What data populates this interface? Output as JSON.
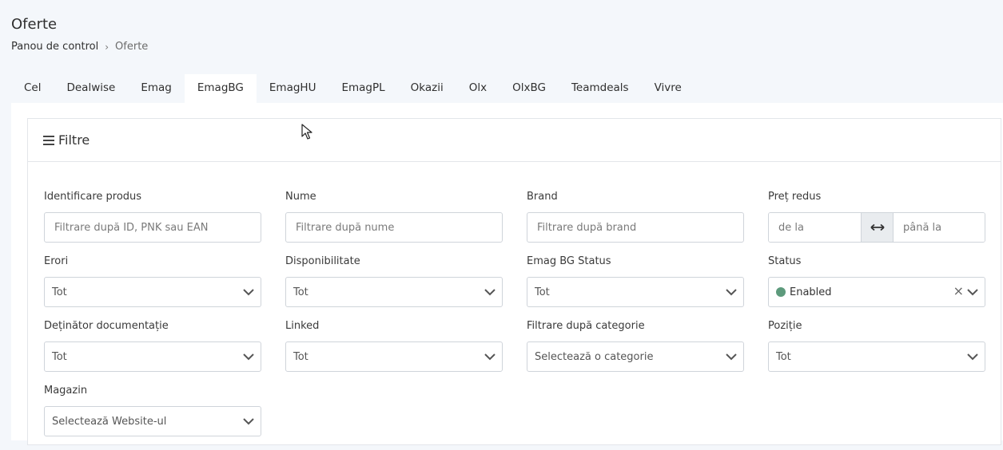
{
  "page": {
    "title": "Oferte"
  },
  "breadcrumb": {
    "home": "Panou de control",
    "separator": "›",
    "current": "Oferte"
  },
  "tabs": [
    {
      "label": "Cel"
    },
    {
      "label": "Dealwise"
    },
    {
      "label": "Emag"
    },
    {
      "label": "EmagBG",
      "active": true
    },
    {
      "label": "EmagHU"
    },
    {
      "label": "EmagPL"
    },
    {
      "label": "Okazii"
    },
    {
      "label": "Olx"
    },
    {
      "label": "OlxBG"
    },
    {
      "label": "Teamdeals"
    },
    {
      "label": "Vivre"
    }
  ],
  "filters": {
    "header": "Filtre",
    "product_id": {
      "label": "Identificare produs",
      "placeholder": "Filtrare după ID, PNK sau EAN"
    },
    "name": {
      "label": "Nume",
      "placeholder": "Filtrare după nume"
    },
    "brand": {
      "label": "Brand",
      "placeholder": "Filtrare după brand"
    },
    "discounted_price": {
      "label": "Preț redus",
      "from_placeholder": "de la",
      "to_placeholder": "până la"
    },
    "errors": {
      "label": "Erori",
      "value": "Tot"
    },
    "availability": {
      "label": "Disponibilitate",
      "value": "Tot"
    },
    "emag_bg_status": {
      "label": "Emag BG Status",
      "value": "Tot"
    },
    "status": {
      "label": "Status",
      "value": "Enabled",
      "dot_color": "#5d9a7c"
    },
    "doc_owner": {
      "label": "Deținător documentație",
      "value": "Tot"
    },
    "linked": {
      "label": "Linked",
      "value": "Tot"
    },
    "category": {
      "label": "Filtrare după categorie",
      "value": "Selectează o categorie"
    },
    "position": {
      "label": "Poziție",
      "value": "Tot"
    },
    "store": {
      "label": "Magazin",
      "value": "Selectează Website-ul"
    }
  },
  "colors": {
    "background": "#f4f7fb",
    "accent_status": "#5d9a7c"
  }
}
